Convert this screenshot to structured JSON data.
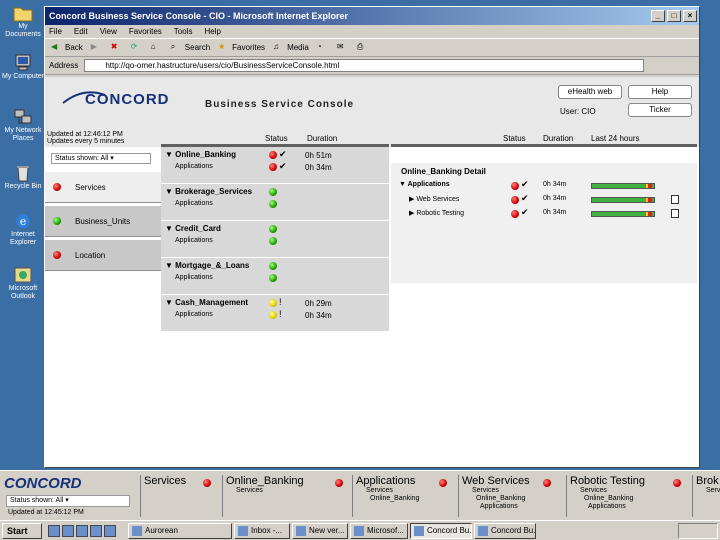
{
  "desktop": {
    "icons": [
      {
        "label": "My Documents",
        "icon": "folder-icon"
      },
      {
        "label": "My Computer",
        "icon": "computer-icon"
      },
      {
        "label": "My Network Places",
        "icon": "network-icon"
      },
      {
        "label": "Recycle Bin",
        "icon": "recycle-bin-icon"
      },
      {
        "label": "Internet Explorer",
        "icon": "ie-icon"
      },
      {
        "label": "Microsoft Outlook",
        "icon": "outlook-icon"
      }
    ]
  },
  "window": {
    "title": "Concord Business Service Console - CIO - Microsoft Internet Explorer",
    "menu": [
      "File",
      "Edit",
      "View",
      "Favorites",
      "Tools",
      "Help"
    ],
    "toolbar": {
      "back": "Back",
      "search": "Search",
      "favorites": "Favorites",
      "media": "Media"
    },
    "address_label": "Address",
    "address_value": "http://qo-omer.hastructure/users/cio/BusinessServiceConsole.html"
  },
  "console": {
    "brand": "CONCORD",
    "title": "Business Service Console",
    "ehealth": "eHealth web",
    "help": "Help",
    "ticker": "Ticker",
    "user": "User: CIO",
    "updated": "Updated at 12:46:12 PM",
    "interval": "Updates every 5 minutes",
    "filter": "Status shown: All",
    "col_status": "Status",
    "col_duration": "Duration",
    "col_last24": "Last 24 hours",
    "nav": [
      {
        "label": "Services",
        "status": "red"
      },
      {
        "label": "Business_Units",
        "status": "green"
      },
      {
        "label": "Location",
        "status": "red"
      }
    ],
    "groups": [
      {
        "name": "Online_Banking",
        "sub": "Applications",
        "status": "red",
        "sub_status": "red",
        "duration": "0h 51m",
        "sub_duration": "0h 34m",
        "check": "✔"
      },
      {
        "name": "Brokerage_Services",
        "sub": "Applications",
        "status": "green",
        "sub_status": "green",
        "duration": "",
        "sub_duration": "",
        "check": ""
      },
      {
        "name": "Credit_Card",
        "sub": "Applications",
        "status": "green",
        "sub_status": "green",
        "duration": "",
        "sub_duration": "",
        "check": ""
      },
      {
        "name": "Mortgage_&_Loans",
        "sub": "Applications",
        "status": "green",
        "sub_status": "green",
        "duration": "",
        "sub_duration": "",
        "check": ""
      },
      {
        "name": "Cash_Management",
        "sub": "Applications",
        "status": "yellow",
        "sub_status": "yellow",
        "duration": "0h 29m",
        "sub_duration": "0h 34m",
        "check": "!"
      }
    ],
    "detail": {
      "title": "Online_Banking Detail",
      "rows": [
        {
          "name": "Applications",
          "duration": "0h 34m",
          "bold": true
        },
        {
          "name": "Web Services",
          "duration": "0h 34m",
          "bold": false
        },
        {
          "name": "Robotic Testing",
          "duration": "0h 34m",
          "bold": false
        }
      ]
    }
  },
  "ticker_bar": {
    "brand": "CONCORD",
    "status": "Status shown: All",
    "updated": "Updated at 12:45:12 PM",
    "cells": [
      {
        "name": "Services",
        "sub1": "",
        "sub2": ""
      },
      {
        "name": "Online_Banking",
        "sub1": "Services",
        "sub2": ""
      },
      {
        "name": "Applications",
        "sub1": "Services",
        "sub2": "Online_Banking"
      },
      {
        "name": "Web Services",
        "sub1": "Services",
        "sub2": "Online_Banking"
      },
      {
        "name": "Robotic Testing",
        "sub1": "Services",
        "sub2": "Online_Banking"
      },
      {
        "name": "Brok",
        "sub1": "Servi",
        "sub2": ""
      }
    ],
    "cell_extra": {
      "web_services_sub3": "Applications",
      "robotic_sub3": "Applications"
    }
  },
  "taskbar": {
    "start": "Start",
    "tasks": [
      "Aurorean",
      "Inbox -...",
      "New ver...",
      "Microsof...",
      "Concord Bu...",
      "Concord Bu..."
    ]
  }
}
